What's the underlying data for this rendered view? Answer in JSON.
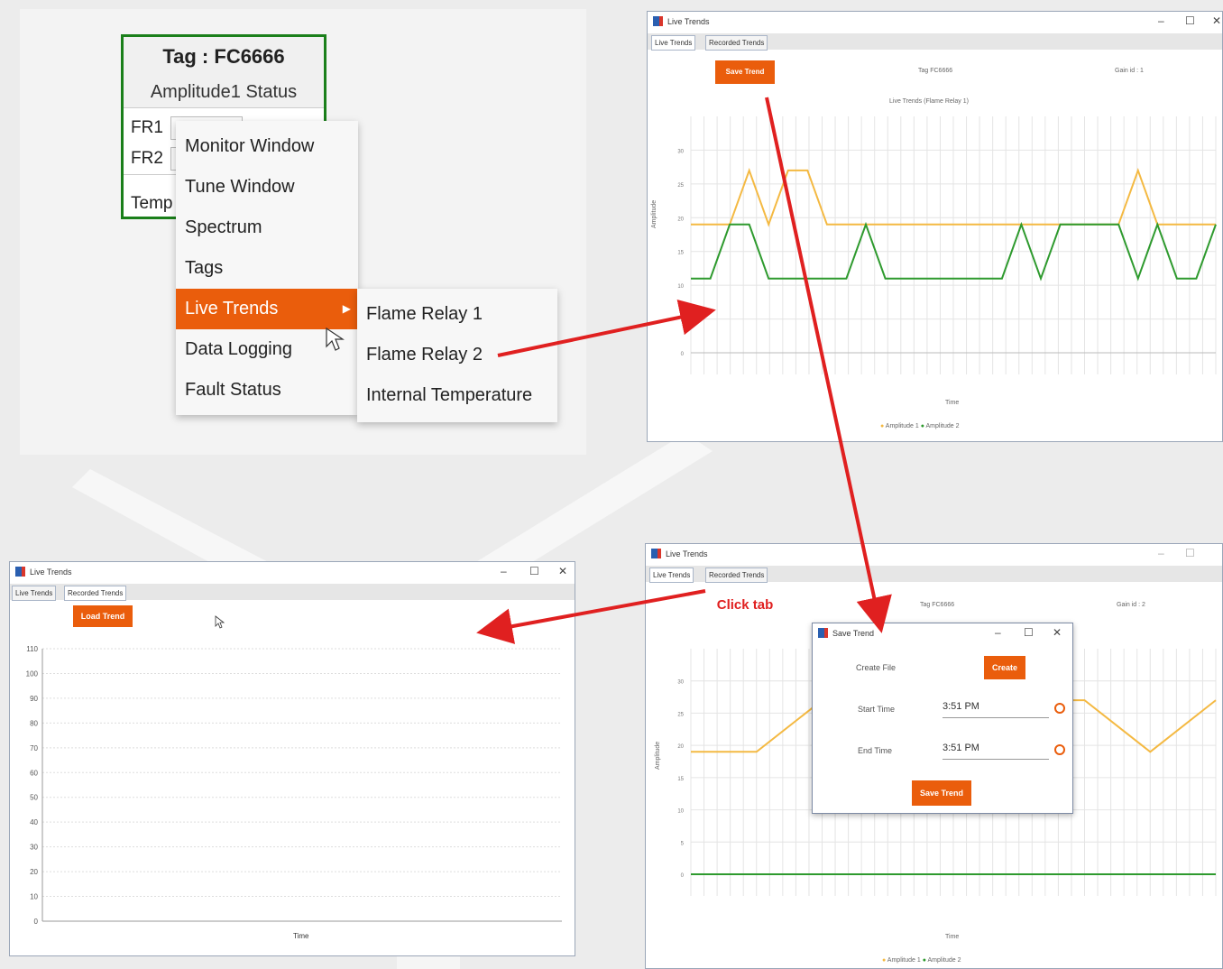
{
  "tag_panel": {
    "title": "Tag : FC6666",
    "status": "Amplitude1 Status",
    "rows": [
      "FR1",
      "FR2",
      "Temp"
    ]
  },
  "context_menu": {
    "items": [
      "Monitor Window",
      "Tune Window",
      "Spectrum",
      "Tags",
      "Live Trends",
      "Data Logging",
      "Fault Status"
    ],
    "active": "Live Trends"
  },
  "submenu": {
    "items": [
      "Flame Relay 1",
      "Flame Relay 2",
      "Internal Temperature"
    ]
  },
  "callout": "Click tab",
  "recorded_window": {
    "title": "Live Trends",
    "tabs": [
      "Live Trends",
      "Recorded Trends"
    ],
    "load_button": "Load Trend",
    "xlabel": "Time",
    "chart_data": {
      "type": "line",
      "x": [],
      "series": [],
      "xlabel": "Time",
      "ylabel": "",
      "ylim": [
        0,
        110
      ],
      "yticks": [
        0,
        10,
        20,
        30,
        40,
        50,
        60,
        70,
        80,
        90,
        100,
        110
      ],
      "grid": true
    }
  },
  "live_window": {
    "title": "Live Trends",
    "tabs": [
      "Live Trends",
      "Recorded Trends"
    ],
    "save_button": "Save Trend",
    "tag_text": "Tag FC6666",
    "gain_text": "Gain id : 1",
    "chart_title": "Live Trends (Flame Relay 1)",
    "ylabel": "Amplitude",
    "xlabel": "Time",
    "legend": [
      "Amplitude 1",
      "Amplitude 2"
    ],
    "colors": {
      "amp1": "#f4b942",
      "amp2": "#2e9a2e"
    },
    "chart_data": {
      "type": "line",
      "ylim": [
        0,
        35
      ],
      "yticks": [
        0,
        5,
        10,
        15,
        20,
        25,
        30
      ],
      "x": [
        0,
        1,
        2,
        3,
        4,
        5,
        6,
        7,
        8,
        9,
        10,
        11,
        12,
        13,
        14,
        15,
        16,
        17,
        18,
        19,
        20,
        21,
        22,
        23,
        24,
        25,
        26,
        27
      ],
      "series": [
        {
          "name": "Amplitude 1",
          "values": [
            19,
            19,
            19,
            27,
            19,
            27,
            27,
            19,
            19,
            19,
            19,
            19,
            19,
            19,
            19,
            19,
            19,
            19,
            19,
            19,
            19,
            19,
            19,
            27,
            19,
            19,
            19,
            19
          ]
        },
        {
          "name": "Amplitude 2",
          "values": [
            11,
            11,
            19,
            19,
            11,
            11,
            11,
            11,
            11,
            19,
            11,
            11,
            11,
            11,
            11,
            11,
            11,
            19,
            11,
            19,
            19,
            19,
            19,
            11,
            19,
            11,
            11,
            19
          ]
        }
      ]
    }
  },
  "save_window": {
    "title": "Live Trends",
    "tabs": [
      "Live Trends",
      "Recorded Trends"
    ],
    "tag_text": "Tag FC6666",
    "gain_text": "Gain id : 2",
    "ylabel": "Amplitude",
    "xlabel": "Time",
    "legend": [
      "Amplitude 1",
      "Amplitude 2"
    ],
    "dialog": {
      "title": "Save Trend",
      "create_label": "Create File",
      "create_button": "Create",
      "start_label": "Start Time",
      "start_value": "3:51 PM",
      "end_label": "End Time",
      "end_value": "3:51 PM",
      "save_button": "Save Trend"
    },
    "chart_data": {
      "type": "line",
      "ylim": [
        0,
        35
      ],
      "yticks": [
        0,
        5,
        10,
        15,
        20,
        25,
        30
      ],
      "series": [
        {
          "name": "Amplitude 1",
          "values": [
            19,
            19,
            27,
            19,
            19,
            27,
            27,
            19,
            27
          ]
        },
        {
          "name": "Amplitude 2",
          "values": [
            0,
            0,
            0,
            0,
            0,
            0,
            0,
            0,
            0
          ]
        }
      ]
    }
  }
}
